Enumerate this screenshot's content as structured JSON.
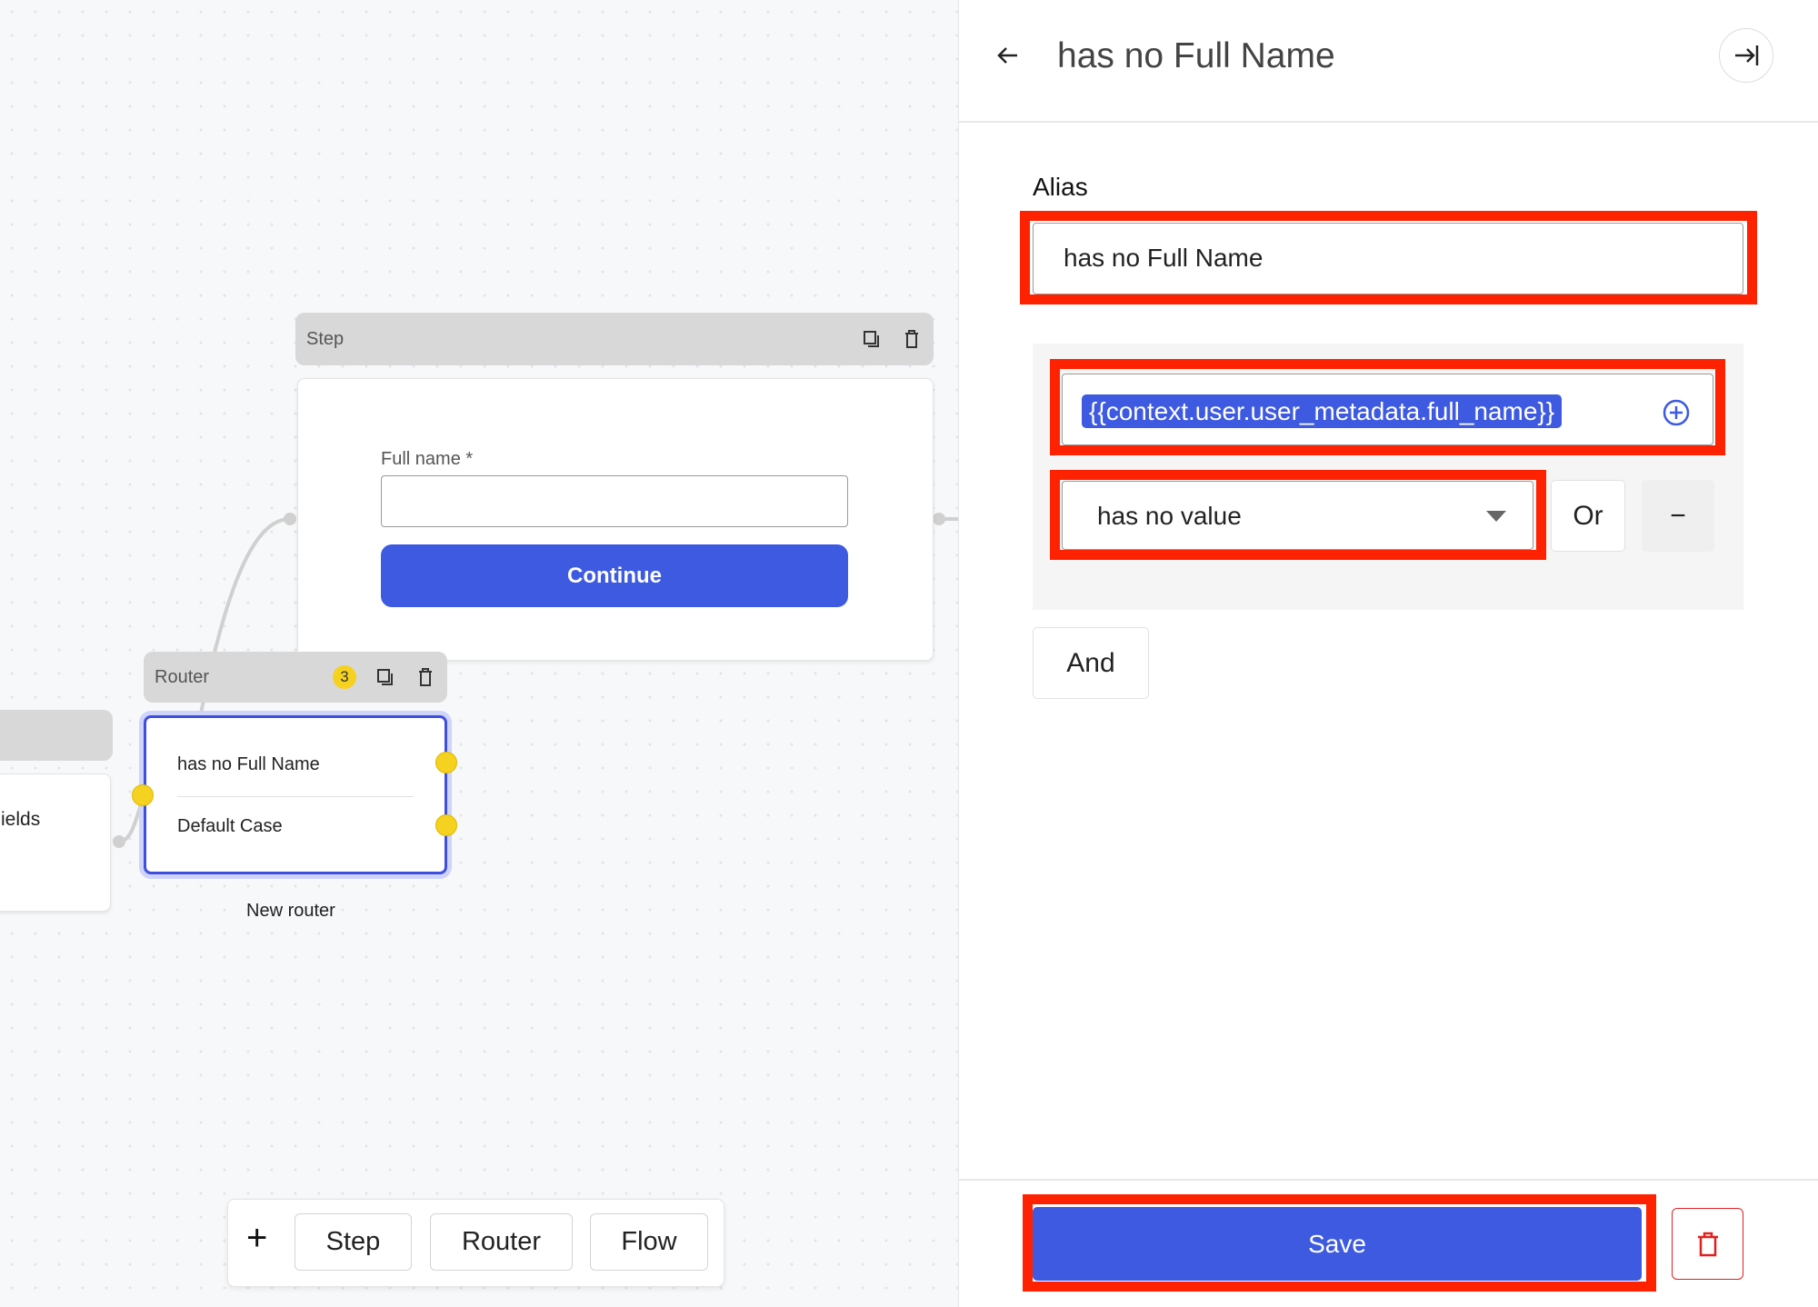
{
  "canvas": {
    "step_node": {
      "header": "Step",
      "field_label": "Full name *",
      "field_value": "",
      "button": "Continue"
    },
    "router_node": {
      "header": "Router",
      "badge": "3",
      "cases": [
        "has no Full Name",
        "Default Case"
      ],
      "caption": "New router"
    },
    "left_node": {
      "partial_text": "ields"
    },
    "toolbar": {
      "add": "+",
      "buttons": [
        "Step",
        "Router",
        "Flow"
      ]
    }
  },
  "panel": {
    "title": "has no Full Name",
    "alias_label": "Alias",
    "alias_value": "has no Full Name",
    "condition": {
      "variable": "{{context.user.user_metadata.full_name}}",
      "operator": "has no value",
      "or_label": "Or",
      "remove_label": "−"
    },
    "and_label": "And",
    "save_label": "Save"
  },
  "colors": {
    "accent": "#3d5ae0",
    "highlight": "#ff2200",
    "port": "#f5d21f"
  }
}
